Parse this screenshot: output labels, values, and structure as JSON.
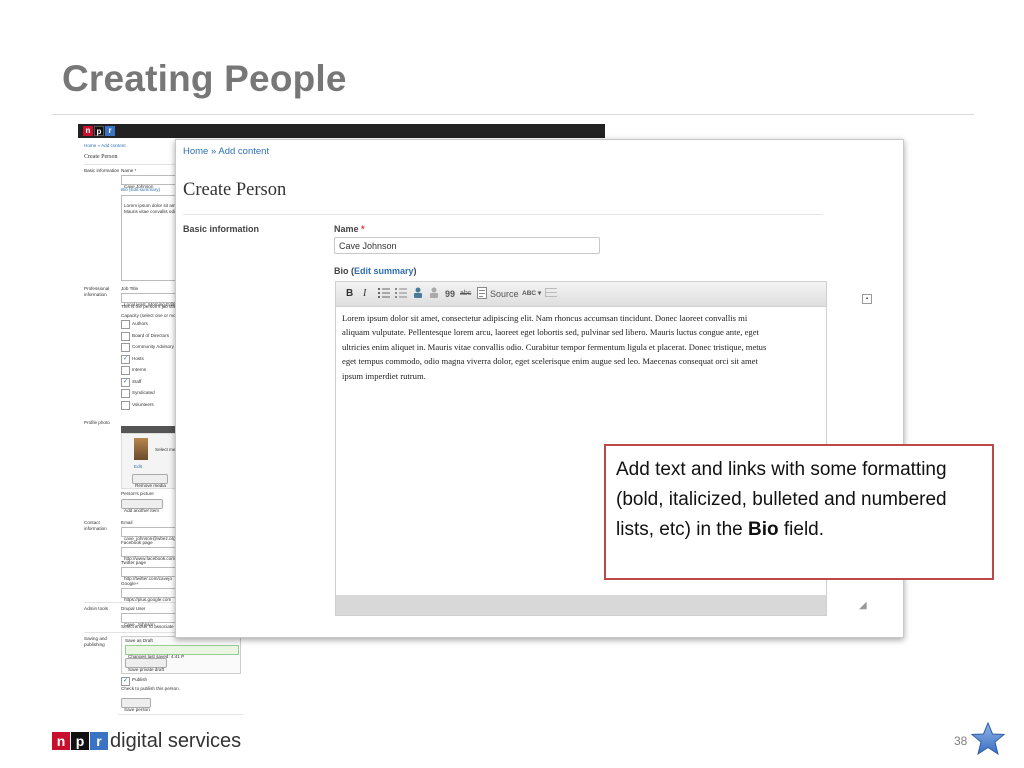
{
  "slide": {
    "title": "Creating People",
    "page_number": "38",
    "footer": {
      "logo_letters": [
        "n",
        "p",
        "r"
      ],
      "text": "digital services"
    }
  },
  "background_screenshot": {
    "header_logo_letters": [
      "n",
      "p",
      "r"
    ],
    "breadcrumb": "Home » Add content",
    "heading": "Create Person",
    "basic_information_label": "Basic information",
    "name_label": "Name *",
    "name_value": "Cave Johnson",
    "bio_label": "Bio (Edit summary)",
    "bio_preview_1": "Lorem ipsum dolor sit amet, c",
    "bio_preview_2": "Mauris vitae convallis odio. C",
    "professional_label": "Professional information",
    "job_title_label": "Job Title",
    "job_title_value": "Local Host, Morning Editio",
    "job_title_hint": "This is the person's job title o",
    "capacity_label": "Capacity (select one or more",
    "capacities": [
      {
        "label": "Authors",
        "checked": false
      },
      {
        "label": "Board of Directors",
        "checked": false
      },
      {
        "label": "Community Advisory Co",
        "checked": false
      },
      {
        "label": "Hosts",
        "checked": true
      },
      {
        "label": "Interns",
        "checked": false
      },
      {
        "label": "Staff",
        "checked": true
      },
      {
        "label": "Syndicated",
        "checked": false
      },
      {
        "label": "Volunteers",
        "checked": false
      }
    ],
    "profile_photo_label": "Profile photo",
    "image_header": "Image",
    "select_media": "Select me",
    "edit_link": "Edit",
    "remove_media": "Remove media",
    "persons_picture": "Person's picture",
    "add_another_item": "Add another item",
    "contact_label": "Contact information",
    "email_label": "Email",
    "email_value": "cave_johnson@wbez.org",
    "facebook_label": "Facebook page",
    "facebook_value": "http://www.facebook.com",
    "twitter_label": "Twitter page",
    "twitter_value": "http://twitter.com/cavejo",
    "googleplus_label": "Google+",
    "googleplus_value": "https://plus.google.com",
    "admin_label": "Admin tools",
    "drupal_user_label": "Drupal User",
    "drupal_user_value": "Cave_Johnson",
    "drupal_user_hint": "Select a user to associate with",
    "saving_label": "Saving and publishing",
    "save_as_draft": "Save as Draft",
    "changes_saved": "Changes last saved: 4:41 P",
    "save_private_draft": "Save private draft",
    "publish_label": "Publish",
    "publish_hint": "Check to publish this person.",
    "save_person": "Save person"
  },
  "front_screenshot": {
    "breadcrumb": "Home » Add content",
    "heading": "Create Person",
    "section_label": "Basic information",
    "name_label": "Name",
    "required_mark": "*",
    "name_value": "Cave Johnson",
    "bio_label": "Bio (",
    "bio_edit_summary": "Edit summary",
    "bio_label_close": ")",
    "toolbar": {
      "bold": "B",
      "italic": "I",
      "blockquote": "99",
      "strike": "abc",
      "source": "Source",
      "spell": "ABC"
    },
    "bio_text": [
      "Lorem ipsum dolor sit amet, consectetur adipiscing elit. Nam rhoncus accumsan tincidunt. Donec laoreet convallis mi",
      "aliquam vulputate. Pellentesque lorem arcu, laoreet eget lobortis sed, pulvinar sed libero. Mauris luctus congue ante, eget",
      "ultricies enim aliquet in. Mauris vitae convallis odio. Curabitur tempor fermentum ligula et placerat. Donec tristique, metus",
      "eget tempus commodo, odio magna viverra dolor, eget scelerisque enim augue sed leo. Maecenas consequat orci sit amet",
      "ipsum imperdiet rutrum."
    ]
  },
  "callout": {
    "text_before": "Add text and links with some formatting (bold, italicized, bulleted and numbered lists, etc) in the ",
    "bold": "Bio",
    "text_after": " field."
  },
  "colors": {
    "title_gray": "#777777",
    "link_blue": "#2f6fb5",
    "callout_border": "#b94a48",
    "npr_n": "#c8102e",
    "npr_p": "#111111",
    "npr_r": "#3a73c4"
  }
}
